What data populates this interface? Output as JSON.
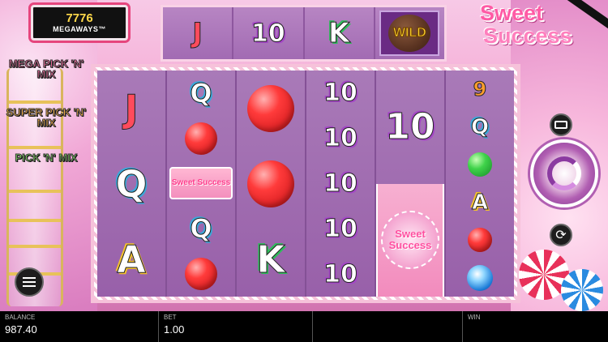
{
  "megaways": {
    "ways": "7776",
    "label": "MEGAWAYS™"
  },
  "logo": {
    "line1": "Sweet",
    "line2": "Success"
  },
  "pick_n_mix": [
    "MEGA PICK 'N' MIX",
    "SUPER PICK 'N' MIX",
    "PICK 'N' MIX"
  ],
  "top_reel": [
    "J",
    "10",
    "K",
    "WILD"
  ],
  "reels": [
    [
      "J",
      "Q",
      "A"
    ],
    [
      "Q",
      "lollipop-red",
      "Sweet Success",
      "Q",
      "lollipop-red"
    ],
    [
      "lollipop-red",
      "lollipop-red",
      "K"
    ],
    [
      "10",
      "10",
      "10",
      "10",
      "10"
    ],
    [
      "10",
      "Sweet Success"
    ],
    [
      "9",
      "Q",
      "gem-green",
      "A",
      "lollipop-red",
      "gem-blue"
    ]
  ],
  "scatter_label": "Sweet Success",
  "wild_label": "WILD",
  "bottom_bar": {
    "balance_label": "BALANCE",
    "balance_value": "987.40",
    "bet_label": "BET",
    "bet_value": "1.00",
    "win_label": "WIN",
    "win_value": ""
  },
  "icons": {
    "cash": "cash-icon",
    "spin": "spin-icon",
    "autoplay": "autoplay-icon",
    "menu": "menu-icon"
  },
  "colors": {
    "bottom_bar": "#000000",
    "reel_bg": "#9a66aa",
    "accent_pink": "#f6c2da"
  }
}
